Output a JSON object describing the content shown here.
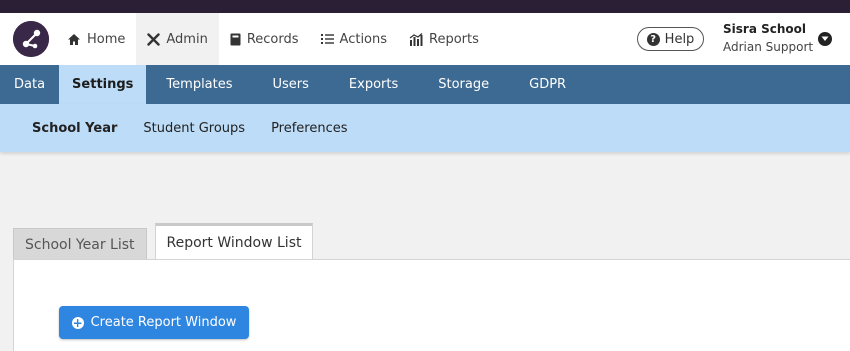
{
  "topnav": {
    "items": [
      {
        "label": "Home",
        "icon": "home-icon"
      },
      {
        "label": "Admin",
        "icon": "tools-icon"
      },
      {
        "label": "Records",
        "icon": "book-icon"
      },
      {
        "label": "Actions",
        "icon": "list-icon"
      },
      {
        "label": "Reports",
        "icon": "chart-icon"
      }
    ],
    "active": "Admin",
    "help_label": "Help",
    "school_name": "Sisra School",
    "user_name": "Adrian Support"
  },
  "mainnav": {
    "tabs": [
      "Data",
      "Settings",
      "Templates",
      "Users",
      "Exports",
      "Storage",
      "GDPR"
    ],
    "active": "Settings"
  },
  "subnav": {
    "tabs": [
      "School Year",
      "Student Groups",
      "Preferences"
    ],
    "active": "School Year"
  },
  "content": {
    "tabs": [
      "School Year List",
      "Report Window List"
    ],
    "active_tab": "Report Window List",
    "create_button_label": "Create Report Window"
  },
  "colors": {
    "top_strip": "#2b1f36",
    "main_nav": "#3d6a92",
    "sub_nav": "#bcdcf7",
    "primary_button": "#2f86e0"
  }
}
